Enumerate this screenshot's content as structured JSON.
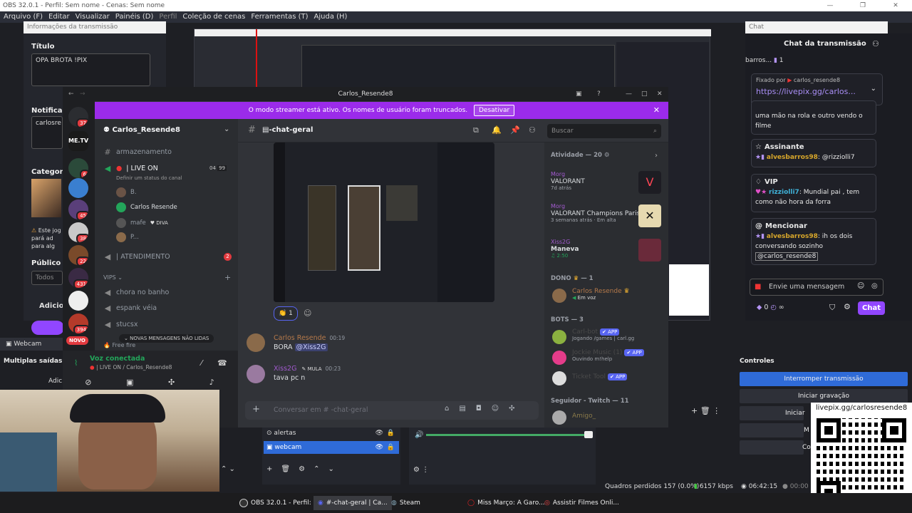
{
  "obs": {
    "window_title": "OBS 32.0.1 - Perfil: Sem nome - Cenas: Sem nome",
    "menu": [
      "Arquivo (F)",
      "Editar",
      "Visualizar",
      "Painéis (D)",
      "Perfil",
      "Coleção de cenas",
      "Ferramentas (T)",
      "Ajuda (H)"
    ],
    "info_panel_title": "Informações da transmissão",
    "titulo_label": "Título",
    "titulo_value": "OPA BROTA !PIX",
    "notif_label": "Notificaç",
    "notif_value": "carlosre",
    "categoria_label": "Categori",
    "warning_text": "Este jog pará ad para alg",
    "publico_label": "Público",
    "publico_value": "Todos",
    "adicionar_label": "Adicior",
    "webcam_label": "Webcam",
    "multiplas_saidas": "Multiplas saídas",
    "adic": "Adic",
    "sources": [
      "alertas",
      "webcam"
    ],
    "controles_label": "Controles",
    "controls": [
      "Interromper transmissão",
      "Iniciar gravação",
      "Iniciar c",
      "M",
      "Co"
    ],
    "status": {
      "dropped": "Quadros perdidos 157 (0.0%)",
      "bitrate": "6157 kbps",
      "time": "06:42:15",
      "rec": "00:00"
    },
    "qr_url": "livepix.gg/carlosresende8"
  },
  "chat": {
    "panel_title": "Chat",
    "header": "Chat da transmissão",
    "top_line": "barros...",
    "top_count": "1",
    "pinned_by": "Fixado por",
    "pinned_user": "carlos_resende8",
    "pinned_link": "https://livepix.gg/carlos...",
    "partial_msg": "uma mão na rola e outro vendo o filme",
    "cards": [
      {
        "title": "Assinante",
        "user": "alvesbarros98",
        "text": ": @rizziolli7"
      },
      {
        "title": "VIP",
        "user": "rizziolli7",
        "text": ": Mundial pai , tem como não hora da forra"
      },
      {
        "title": "Mencionar",
        "user": "alvesbarros98",
        "text": ": ih os dois conversando sozinho",
        "tag": "@carlos_resende8"
      }
    ],
    "input_placeholder": "Envie uma mensagem",
    "points": "0",
    "send_label": "Chat"
  },
  "discord": {
    "window_title": "Carlos_Resende8",
    "banner_text": "O modo streamer está ativo. Os nomes de usuário foram truncados.",
    "banner_button": "Desativar",
    "server_name": "Carlos_Resende8",
    "channels": {
      "armazenamento": "armazenamento",
      "live_on": "| LIVE ON",
      "live_sub": "Definir um status do canal",
      "live_count1": "04",
      "live_count2": "99",
      "voice_users": [
        "B.",
        "Carlos Resende",
        "mafe",
        "P..."
      ],
      "diva_tag": "DIVA",
      "atendimento": "| ATENDIMENTO",
      "atendimento_badge": "2",
      "vips_cat": "VIPS",
      "vip_channels": [
        "chora no banho",
        "espank véia",
        "stucsx"
      ],
      "free_fire": "Free fire",
      "new_msgs": "NOVAS MENSAGENS NÃO LIDAS"
    },
    "guild_badges": [
      "37",
      "6",
      "45",
      "38",
      "22",
      "431",
      "394"
    ],
    "novo": "NOVO",
    "voice_connected": "Voz conectada",
    "voice_channel": "| LIVE ON / Carlos_Resende8",
    "current_channel": "-chat-geral",
    "search_placeholder": "Buscar",
    "reaction_count": "1",
    "messages": [
      {
        "author": "Carlos Resende",
        "time": "00:19",
        "text": "BORA ",
        "mention": "@Xiss2G"
      },
      {
        "author": "Xiss2G",
        "tag": "MULA",
        "time": "00:23",
        "text": "tava pc n"
      }
    ],
    "composer_placeholder": "Conversar em # -chat-geral",
    "members": {
      "activity_header": "Atividade — 20",
      "activities": [
        {
          "name": "Morg",
          "game": "VALORANT",
          "when": "7d atrás"
        },
        {
          "name": "Morg",
          "game": "VALORANT Champions Paris",
          "when": "3 semanas atrás",
          "extra": "Em alta"
        },
        {
          "name": "Xiss2G",
          "game": "Maneva",
          "when": "2:50"
        }
      ],
      "owner_header": "DONO",
      "owner_count": "— 1",
      "owner_name": "Carlos Resende",
      "owner_status": "Em voz",
      "bots_header": "BOTS — 3",
      "bots": [
        {
          "name": "Carl-bot",
          "status": "Jogando /games | carl.gg"
        },
        {
          "name": "Jockie Music (1)",
          "status": "Ouvindo m!help"
        },
        {
          "name": "Ticket Tool",
          "status": ""
        }
      ],
      "app_label": "APP",
      "twitch_header": "Seguidor - Twitch — 11",
      "twitch_first": "Amigo_"
    }
  },
  "taskbar": [
    {
      "label": "OBS 32.0.1 - Perfil: ..."
    },
    {
      "label": "#-chat-geral | Ca..."
    },
    {
      "label": "Steam"
    },
    {
      "label": "Miss Março: A Garo..."
    },
    {
      "label": "Assistir Filmes Onli..."
    }
  ],
  "colors": {
    "discord_bg": "#313338",
    "discord_accent": "#9b2bea",
    "obs_bg": "#24262d",
    "twitch_purple": "#9146ff",
    "control_active": "#2f6bd8"
  }
}
